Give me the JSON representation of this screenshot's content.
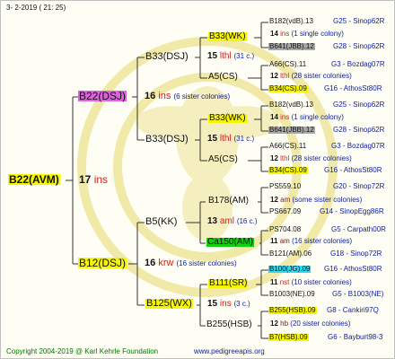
{
  "header": {
    "date": "3-  2-2019 ( 21: 25)"
  },
  "colors": {
    "yellow": "#f7f700",
    "magenta": "#e060e0",
    "green": "#10d010",
    "grey": "#a8a8a8",
    "cyan": "#30d8f0",
    "brand_blue": "#1020a0",
    "brand_red": "#cc2020"
  },
  "root": {
    "label": "B22(AVM)",
    "ins_num": "17",
    "ins_word": "ins"
  },
  "gen1": [
    {
      "label": "B22(DSJ)",
      "num": "16",
      "word": "ins",
      "note": "(6 sister colonies)"
    },
    {
      "label": "B12(DSJ)",
      "num": "16",
      "word": "krw",
      "note": "(16 sister colonies)"
    }
  ],
  "gen2": [
    {
      "label": "B33(DSJ)",
      "num": "15",
      "word": "lthl",
      "note": "(31 c.)"
    },
    {
      "label": "B33(DSJ)",
      "num": "15",
      "word": "lthl",
      "note": "(31 c.)"
    },
    {
      "label": "B5(KK)",
      "num": "13",
      "word": "aml",
      "note": "(16 c.)"
    },
    {
      "label": "B125(WX)",
      "num": "15",
      "word": "ins",
      "note": "(3 c.)"
    }
  ],
  "gen3": [
    {
      "label": "B33(WK)",
      "num": "14",
      "word": "ins",
      "note": "(1 single colony)"
    },
    {
      "label": "A5(CS)",
      "num": "12",
      "word": "lthl",
      "note": "(28 sister colonies)"
    },
    {
      "label": "B33(WK)",
      "num": "14",
      "word": "ins",
      "note": "(1 single colony)"
    },
    {
      "label": "A5(CS)",
      "num": "12",
      "word": "lthl",
      "note": "(28 sister colonies)"
    },
    {
      "label": "B178(AM)",
      "num": "12",
      "word": "am",
      "note": "(some sister colonies)"
    },
    {
      "label": "Ca150(AM)",
      "num": "11",
      "word": "am",
      "note": "(16 sister colonies)"
    },
    {
      "label": "B111(SR)",
      "num": "11",
      "word": "nst",
      "note": "(10 sister colonies)"
    },
    {
      "label": "B255(HSB)",
      "num": "12",
      "word": "hb",
      "note": "(20 sister colonies)"
    }
  ],
  "gen4": [
    {
      "label": "B182(vdB).13",
      "group": "G25 - Sinop62R"
    },
    {
      "label": "B641(JBB).12",
      "group": "G28 - Sinop62R"
    },
    {
      "label": "A66(CS).11",
      "group": "G3 - Bozdag07R"
    },
    {
      "label": "B34(CS).09",
      "group": "G16 - AthosSt80R"
    },
    {
      "label": "B182(vdB).13",
      "group": "G25 - Sinop62R"
    },
    {
      "label": "B641(JBB).12",
      "group": "G28 - Sinop62R"
    },
    {
      "label": "A66(CS).11",
      "group": "G3 - Bozdag07R"
    },
    {
      "label": "B34(CS).09",
      "group": "G16 - AthosSt80R"
    },
    {
      "label": "PS559.10",
      "group": "G20 - Sinop72R"
    },
    {
      "label": "PS667.09",
      "group": "G14 - SinopEgg86R"
    },
    {
      "label": "PS704.08",
      "group": "G5 - Carpath00R"
    },
    {
      "label": "B121(AM).06",
      "group": "G18 - Sinop72R"
    },
    {
      "label": "B100(JG).09",
      "group": "G16 - AthosSt80R"
    },
    {
      "label": "B1003(NE).09",
      "group": "G5 - B1003(NE)"
    },
    {
      "label": "B255(HSB).09",
      "group": "G8 - Cankiri97Q"
    },
    {
      "label": "B7(HSB).09",
      "group": "G6 - Bayburt98-3"
    }
  ],
  "footer": {
    "copyright": "Copyright 2004-2019 @ Karl Kehrle Foundation",
    "website": "www.pedigreeapis.org"
  }
}
